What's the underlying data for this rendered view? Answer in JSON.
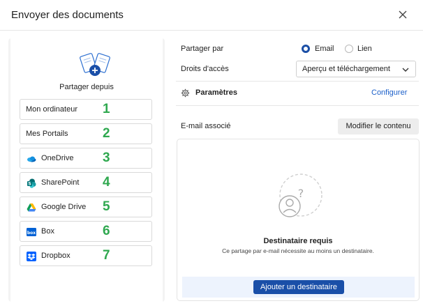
{
  "dialog": {
    "title": "Envoyer des documents",
    "close_icon": "close-icon"
  },
  "source": {
    "caption": "Partager depuis",
    "icon": "upload-documents-icon",
    "items": [
      {
        "label": "Mon ordinateur",
        "number": "1",
        "icon": null
      },
      {
        "label": "Mes Portails",
        "number": "2",
        "icon": null
      },
      {
        "label": "OneDrive",
        "number": "3",
        "icon": "onedrive-icon"
      },
      {
        "label": "SharePoint",
        "number": "4",
        "icon": "sharepoint-icon"
      },
      {
        "label": "Google Drive",
        "number": "5",
        "icon": "google-drive-icon"
      },
      {
        "label": "Box",
        "number": "6",
        "icon": "box-icon"
      },
      {
        "label": "Dropbox",
        "number": "7",
        "icon": "dropbox-icon"
      }
    ],
    "number_color": "#2fa84f"
  },
  "share": {
    "label": "Partager par",
    "options": [
      {
        "label": "Email",
        "selected": true
      },
      {
        "label": "Lien",
        "selected": false
      }
    ]
  },
  "access": {
    "label": "Droits d'accès",
    "value": "Aperçu et téléchargement"
  },
  "settings": {
    "label": "Paramètres",
    "link": "Configurer",
    "icon": "gear-icon"
  },
  "email": {
    "label": "E-mail associé",
    "modify_button": "Modifier le contenu"
  },
  "recipient": {
    "title": "Destinataire requis",
    "subtitle": "Ce partage par e-mail nécessite au moins un destinataire.",
    "add_button": "Ajouter un destinataire"
  },
  "colors": {
    "primary": "#1a4fa8",
    "link": "#1b5fc9",
    "footer_bg": "#edf3fd"
  }
}
